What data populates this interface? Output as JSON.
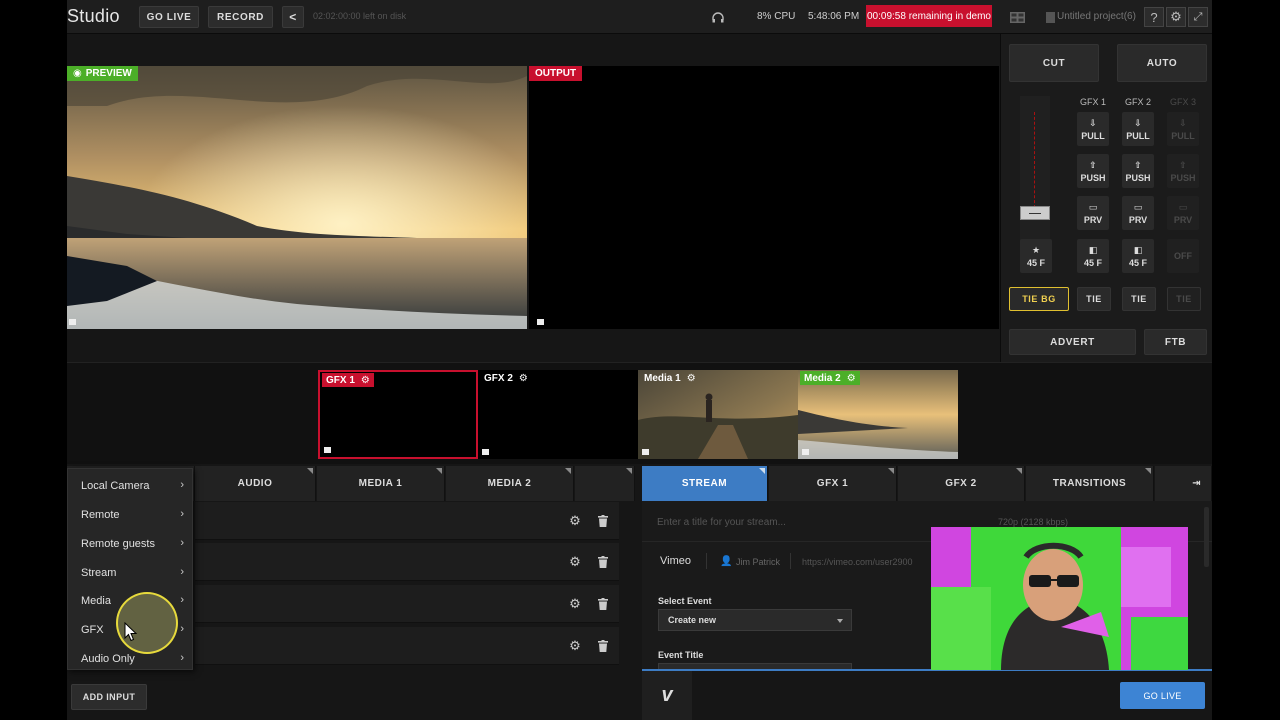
{
  "topbar": {
    "brand": "Studio",
    "go_live": "GO LIVE",
    "record": "RECORD",
    "disk": "02:02:00:00 left on disk",
    "cpu": "8% CPU",
    "time": "5:48:06 PM",
    "demo": "00:09:58 remaining in demo",
    "project": "Untitled project(6)"
  },
  "monitors": {
    "preview_label": "PREVIEW",
    "output_label": "OUTPUT",
    "preview_color": "#4caf28",
    "output_color": "#c8102e"
  },
  "controls": {
    "cut": "CUT",
    "auto": "AUTO",
    "gfx_headers": [
      "GFX 1",
      "GFX 2",
      "GFX 3"
    ],
    "pull": "PULL",
    "push": "PUSH",
    "prv": "PRV",
    "frames": "45 F",
    "off": "OFF",
    "tie_bg": "TIE BG",
    "tie": "TIE",
    "advert": "ADVERT",
    "ftb": "FTB"
  },
  "thumbnails": [
    {
      "label": "GFX 1",
      "color": "#c8102e"
    },
    {
      "label": "GFX 2",
      "color": ""
    },
    {
      "label": "Media 1",
      "color": ""
    },
    {
      "label": "Media 2",
      "color": "#4caf28"
    }
  ],
  "left_tabs": [
    "AUDIO",
    "MEDIA 1",
    "MEDIA 2"
  ],
  "menu": {
    "items": [
      "Local Camera",
      "Remote",
      "Remote guests",
      "Stream",
      "Media",
      "GFX",
      "Audio Only"
    ]
  },
  "add_input": "ADD INPUT",
  "right_tabs": [
    "STREAM",
    "GFX 1",
    "GFX 2",
    "TRANSITIONS"
  ],
  "stream": {
    "title_placeholder": "Enter a title for your stream...",
    "resolution": "720p (2128 kbps)",
    "service": "Vimeo",
    "user": "Jim Patrick",
    "url": "https://vimeo.com/user2900",
    "select_event_label": "Select Event",
    "select_event_value": "Create new",
    "event_title_label": "Event Title",
    "go_live": "GO LIVE",
    "vimeo_logo": "v"
  }
}
